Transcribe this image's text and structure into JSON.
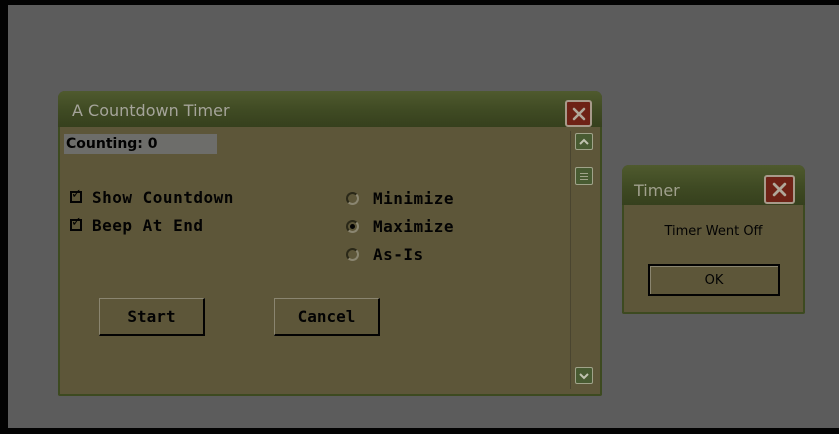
{
  "main_window": {
    "title": "A Countdown Timer",
    "counting_label": "Counting: 0",
    "checkboxes": [
      {
        "label": "Show Countdown",
        "checked": true
      },
      {
        "label": "Beep At End",
        "checked": true
      }
    ],
    "radios": [
      {
        "label": "Minimize",
        "selected": false
      },
      {
        "label": "Maximize",
        "selected": true
      },
      {
        "label": "As-Is",
        "selected": false
      }
    ],
    "start_label": "Start",
    "cancel_label": "Cancel"
  },
  "message_box": {
    "title": "Timer",
    "message": "Timer Went Off",
    "ok_label": "OK"
  },
  "icons": {
    "close": "close-icon",
    "scroll_up": "chevron-up-icon",
    "scroll_down": "chevron-down-icon",
    "scroll_thumb": "grip-icon",
    "check": "check-icon"
  },
  "colors": {
    "titlebar": "#3f4a23",
    "window_body": "#5d5639",
    "close_button": "#6e2216",
    "desktop": "#5c5c5c"
  }
}
